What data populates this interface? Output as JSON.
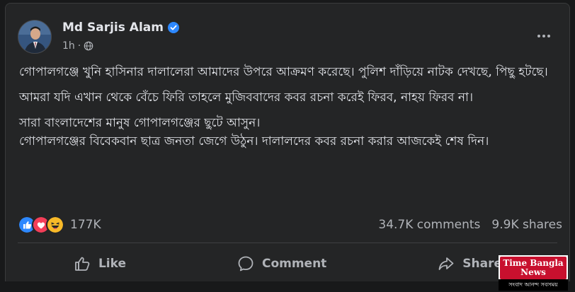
{
  "post": {
    "author_name": "Md Sarjis Alam",
    "time": "1h",
    "separator": "·",
    "paragraphs": [
      "গোপালগঞ্জে খুনি হাসিনার দালালেরা আমাদের উপরে আক্রমণ করেছে। পুলিশ দাঁড়িয়ে নাটক দেখছে, পিছু হটছে।",
      "আমরা যদি এখান থেকে বেঁচে ফিরি তাহলে মুজিববাদের কবর রচনা করেই ফিরব, নাহয় ফিরব না।",
      "সারা বাংলাদেশের মানুষ গোপালগঞ্জের ছুটে আসুন।\nগোপালগঞ্জের বিবেকবান ছাত্র জনতা জেগে উঠুন। দালালদের কবর রচনা করার আজকেই শেষ দিন।"
    ]
  },
  "stats": {
    "reactions_count": "177K",
    "comments": "34.7K comments",
    "shares": "9.9K shares"
  },
  "actions": {
    "like": "Like",
    "comment": "Comment",
    "share": "Share"
  },
  "watermark": {
    "line1": "Time Bangla",
    "line2": "News",
    "tagline": "সংবাদ আনন্দ সবসময়"
  },
  "colors": {
    "background": "#18191a",
    "card": "#242526",
    "text_primary": "#e4e6eb",
    "text_secondary": "#b0b3b8",
    "verified": "#2d88ff",
    "like_reaction": "#2d88ff",
    "love_reaction": "#f33e58",
    "haha_reaction": "#f7b928",
    "watermark_red": "#c8102e"
  },
  "icons": [
    "verified-badge-icon",
    "globe-icon",
    "more-options-icon",
    "like-reaction-icon",
    "love-reaction-icon",
    "haha-reaction-icon",
    "thumbs-up-icon",
    "comment-bubble-icon",
    "share-arrow-icon"
  ]
}
